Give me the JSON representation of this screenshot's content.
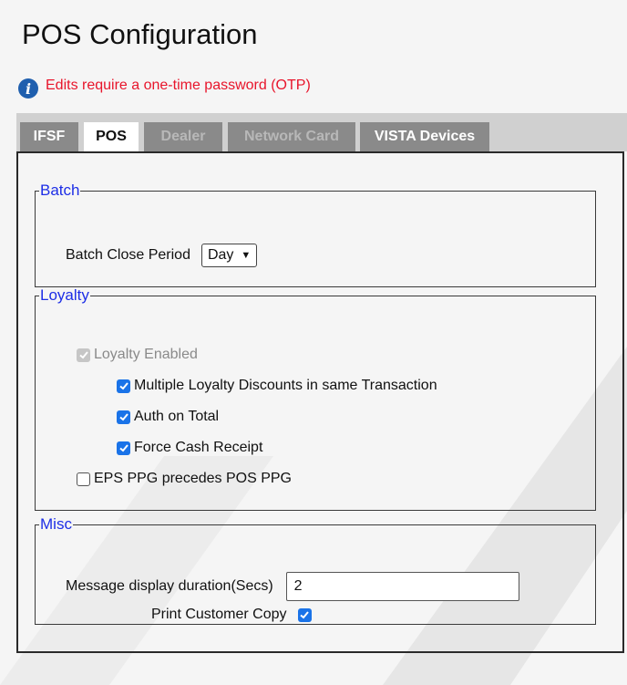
{
  "page": {
    "title": "POS Configuration"
  },
  "notice": {
    "text": "Edits require a one-time password (OTP)",
    "icon": "info-icon",
    "color": "#e8152b"
  },
  "tabs": [
    {
      "label": "IFSF",
      "state": "normal"
    },
    {
      "label": "POS",
      "state": "active"
    },
    {
      "label": "Dealer",
      "state": "disabled"
    },
    {
      "label": "Network Card",
      "state": "disabled"
    },
    {
      "label": "VISTA Devices",
      "state": "normal"
    }
  ],
  "batch": {
    "legend": "Batch",
    "close_period_label": "Batch Close Period",
    "close_period_value": "Day"
  },
  "loyalty": {
    "legend": "Loyalty",
    "enabled_label": "Loyalty Enabled",
    "enabled_checked": true,
    "enabled_disabled": true,
    "multiple_label": "Multiple Loyalty Discounts in same Transaction",
    "multiple_checked": true,
    "auth_label": "Auth on Total",
    "auth_checked": true,
    "force_label": "Force Cash Receipt",
    "force_checked": true,
    "eps_label": "EPS PPG precedes POS PPG",
    "eps_checked": false
  },
  "misc": {
    "legend": "Misc",
    "duration_label": "Message display duration(Secs)",
    "duration_value": "2",
    "print_label": "Print Customer Copy",
    "print_checked": true
  },
  "colors": {
    "legend": "#1d2ee6",
    "accent": "#1a73e8",
    "tab_bg": "#8a8a8a"
  }
}
